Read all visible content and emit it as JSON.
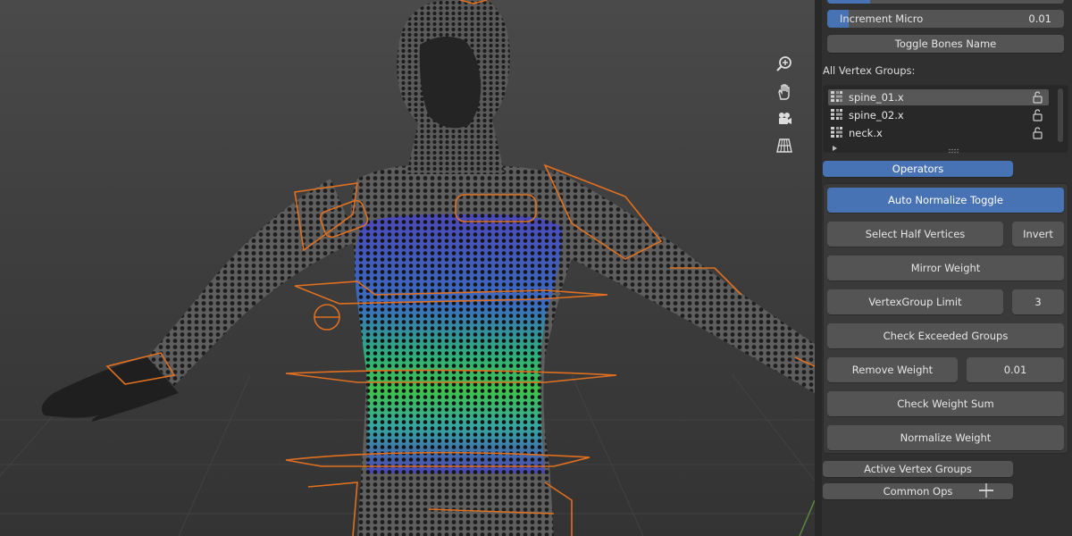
{
  "viewport": {
    "nav_icons": [
      "zoom-icon",
      "pan-hand-icon",
      "camera-icon",
      "perspective-grid-icon"
    ],
    "colors": {
      "background": "#3e3e3e",
      "armature": "#e07020",
      "mesh": "#2b2b2b"
    }
  },
  "panel": {
    "increment_micro": {
      "label": "Increment Micro",
      "value": "0.01"
    },
    "toggle_bones_name": "Toggle Bones Name",
    "all_vertex_groups_label": "All Vertex Groups:",
    "vertex_groups": [
      {
        "name": "spine_01.x",
        "selected": true
      },
      {
        "name": "spine_02.x",
        "selected": false
      },
      {
        "name": "neck.x",
        "selected": false
      }
    ],
    "operators_header": "Operators",
    "operators": {
      "auto_normalize": "Auto Normalize Toggle",
      "select_half": "Select Half Vertices",
      "invert": "Invert",
      "mirror_weight": "Mirror Weight",
      "vertexgroup_limit": "VertexGroup Limit",
      "vertexgroup_limit_value": "3",
      "check_exceeded": "Check Exceeded Groups",
      "remove_weight": "Remove Weight",
      "remove_weight_value": "0.01",
      "check_weight_sum": "Check Weight Sum",
      "normalize_weight": "Normalize Weight"
    },
    "active_vertex_groups_header": "Active Vertex Groups",
    "common_ops_header": "Common Ops",
    "colors": {
      "accent": "#4772b3",
      "button": "#545454",
      "panel": "#303030"
    }
  }
}
